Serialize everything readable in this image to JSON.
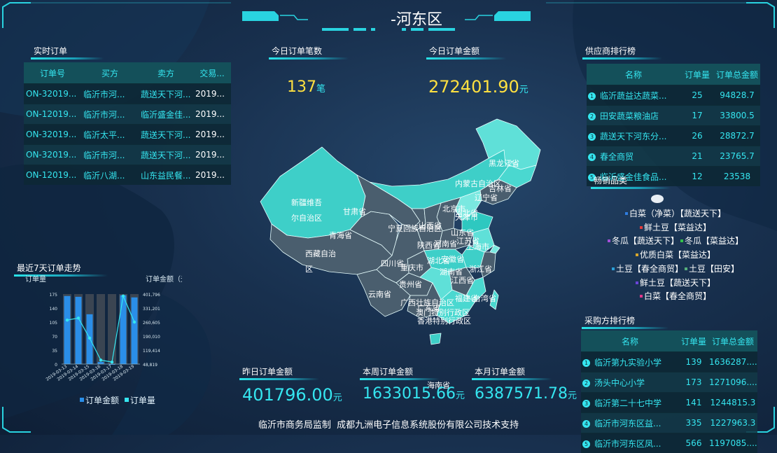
{
  "header": {
    "title": "-河东区"
  },
  "realtime_orders": {
    "title": "实时订单",
    "columns": [
      "订单号",
      "买方",
      "卖方",
      "交易..."
    ],
    "rows": [
      [
        "ON-32019...",
        "临沂市河...",
        "蔬送天下河...",
        "2019..."
      ],
      [
        "ON-12019...",
        "临沂市河...",
        "临沂盛金佳...",
        "2019..."
      ],
      [
        "ON-32019...",
        "临沂太平...",
        "蔬送天下河...",
        "2019..."
      ],
      [
        "ON-32019...",
        "临沂市河...",
        "蔬送天下河...",
        "2019..."
      ],
      [
        "ON-12019...",
        "临沂八湖...",
        "山东益民餐...",
        "2019..."
      ]
    ]
  },
  "kpis": {
    "today_count": {
      "label": "今日订单笔数",
      "value": "137",
      "unit": "笔"
    },
    "today_amount": {
      "label": "今日订单金额",
      "value": "272401.90",
      "unit": "元"
    },
    "yesterday_amount": {
      "label": "昨日订单金额",
      "value": "401796.00",
      "unit": "元"
    },
    "week_amount": {
      "label": "本周订单金额",
      "value": "1633015.66",
      "unit": "元"
    },
    "month_amount": {
      "label": "本月订单金额",
      "value": "6387571.78",
      "unit": "元"
    }
  },
  "supplier_rank": {
    "title": "供应商排行榜",
    "columns": [
      "名称",
      "订单量",
      "订单总金额"
    ],
    "rows": [
      {
        "rank": "1",
        "name": "临沂蔬益达蔬菜...",
        "qty": "25",
        "amount": "94828.7"
      },
      {
        "rank": "2",
        "name": "田安蔬菜粮油店",
        "qty": "17",
        "amount": "33800.5"
      },
      {
        "rank": "3",
        "name": "蔬送天下河东分...",
        "qty": "26",
        "amount": "28872.7"
      },
      {
        "rank": "4",
        "name": "春全商贸",
        "qty": "21",
        "amount": "23765.7"
      },
      {
        "rank": "5",
        "name": "临沂盛金佳食品...",
        "qty": "12",
        "amount": "23538"
      }
    ]
  },
  "best_sellers": {
    "title": "畅销品类",
    "items": [
      {
        "label": "白菜（净菜）【蔬送天下】",
        "color": "#2f7de0"
      },
      {
        "label": "鲜土豆【菜益达】",
        "color": "#e03a3a"
      },
      {
        "label": "冬瓜【蔬送天下】",
        "color": "#a34fd8"
      },
      {
        "label": "冬瓜【菜益达】",
        "color": "#33c24a"
      },
      {
        "label": "优质白菜【菜益达】",
        "color": "#d8a62b"
      },
      {
        "label": "土豆【春全商贸】",
        "color": "#2aa0d8"
      },
      {
        "label": "土豆【田安】",
        "color": "#56b07c"
      },
      {
        "label": "鲜土豆【蔬送天下】",
        "color": "#6a44d8"
      },
      {
        "label": "白菜【春全商贸】",
        "color": "#e0388a"
      }
    ]
  },
  "buyer_rank": {
    "title": "采购方排行榜",
    "columns": [
      "名称",
      "订单量",
      "订单总金额"
    ],
    "rows": [
      {
        "rank": "1",
        "name": "临沂第九实验小学",
        "qty": "139",
        "amount": "1636287...."
      },
      {
        "rank": "2",
        "name": "汤头中心小学",
        "qty": "173",
        "amount": "1271096...."
      },
      {
        "rank": "3",
        "name": "临沂第二十七中学",
        "qty": "141",
        "amount": "1244815.3"
      },
      {
        "rank": "4",
        "name": "临沂市河东区益...",
        "qty": "335",
        "amount": "1227963.3"
      },
      {
        "rank": "5",
        "name": "临沂市河东区凤...",
        "qty": "566",
        "amount": "1197085...."
      }
    ]
  },
  "trend": {
    "title": "最近7天订单走势",
    "left_axis_label": "订单量",
    "right_axis_label": "订单金额（元）",
    "legend": [
      "订单金额",
      "订单量"
    ]
  },
  "chart_data": {
    "type": "bar",
    "categories": [
      "2019-03-13",
      "2019-03-14",
      "2019-03-15",
      "2019-03-16",
      "2019-03-17",
      "2019-03-18",
      "2019-03-19"
    ],
    "series": [
      {
        "name": "订单金额",
        "type": "bar",
        "axis": "right",
        "values": [
          392000,
          388000,
          300000,
          60000,
          48819,
          396000,
          385000
        ]
      },
      {
        "name": "订单量",
        "type": "line",
        "axis": "left",
        "values": [
          110,
          115,
          65,
          10,
          5,
          170,
          105
        ]
      }
    ],
    "left_ylim": [
      0,
      175
    ],
    "left_ticks": [
      "0",
      "35",
      "70",
      "105",
      "140",
      "175"
    ],
    "right_ylim": [
      48819,
      401796
    ],
    "right_ticks": [
      "48,819",
      "119,414",
      "190,010",
      "260,605",
      "331,201",
      "401,796"
    ]
  },
  "map": {
    "provinces": [
      "黑龙江省",
      "吉林省",
      "辽宁省",
      "内蒙古自治区",
      "新疆维吾尔自治区",
      "甘肃省",
      "青海省",
      "宁夏回族自治区",
      "陕西省",
      "山西省",
      "河北省",
      "北京市",
      "天津市",
      "山东省",
      "河南省",
      "江苏省",
      "安徽省",
      "上海市",
      "浙江省",
      "湖北省",
      "重庆市",
      "四川省",
      "西藏自治区",
      "贵州省",
      "湖南省",
      "江西省",
      "福建省",
      "云南省",
      "广西壮族自治区",
      "广东省",
      "海南省",
      "台湾省",
      "香港特别行政区",
      "澳门特别行政区"
    ]
  },
  "footer": {
    "text": "临沂市商务局监制  成都九洲电子信息系统股份有限公司技术支持"
  }
}
